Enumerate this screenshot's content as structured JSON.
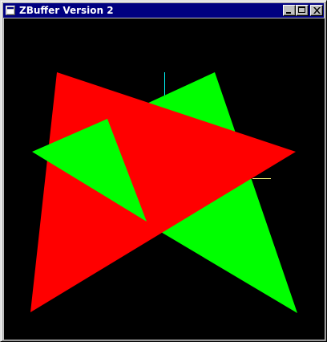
{
  "window": {
    "title": "ZBuffer Version 2",
    "icon": "app-window-icon",
    "buttons": {
      "minimize_icon": "minimize-icon",
      "maximize_icon": "maximize-icon",
      "close_icon": "close-icon"
    }
  },
  "scene": {
    "background_color": "#000000",
    "colors": {
      "red": "#ff0000",
      "green": "#00ff00",
      "axis_y": "#00ffff",
      "axis_x": "#ffff80"
    }
  }
}
